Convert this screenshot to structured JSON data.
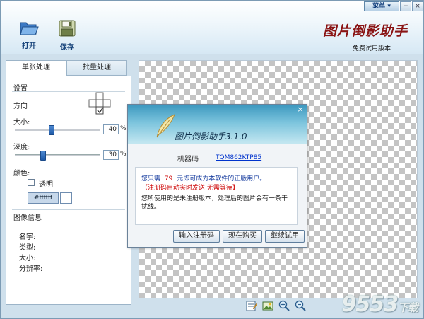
{
  "toolbar": {
    "open_label": "打开",
    "save_label": "保存",
    "menu_label": "菜单",
    "minimize": "−",
    "close": "×"
  },
  "brand": {
    "logo_text": "图片倒影助手",
    "edition": "免费试用版本"
  },
  "tabs": [
    {
      "label": "单张处理",
      "active": true
    },
    {
      "label": "批量处理",
      "active": false
    }
  ],
  "settings": {
    "title": "设置",
    "direction_label": "方向",
    "size_label": "大小:",
    "size_value": "40",
    "size_level": 0.4,
    "depth_label": "深度:",
    "depth_value": "30",
    "depth_level": 0.3,
    "percent_unit": "%",
    "color_label": "颜色:",
    "transparent_label": "透明",
    "transparent_checked": false,
    "color_value": "#ffffff"
  },
  "image_info": {
    "title": "图像信息",
    "name_label": "名字:",
    "type_label": "类型:",
    "size_label": "大小:",
    "resolution_label": "分辨率:"
  },
  "dialog": {
    "title": "图片倒影助手3.1.0",
    "close": "×",
    "machine_code_label": "机器码",
    "machine_code": "TQM862KTP85",
    "price_prefix": "您只需",
    "price": "79",
    "price_suffix": "元即可成为本软件的正版用户。",
    "notice": "【注册码自动实时发送,无需等待】",
    "message": "您所使用的是未注册版本，处理后的图片会有一条干扰线。",
    "btn_register": "输入注册码",
    "btn_buy": "现在购买",
    "btn_trial": "继续试用"
  },
  "watermark": {
    "digits": "9553",
    "suffix": "下载"
  },
  "colors": {
    "accent": "#17437a",
    "price": "#cc0000",
    "link": "#0033cc"
  }
}
